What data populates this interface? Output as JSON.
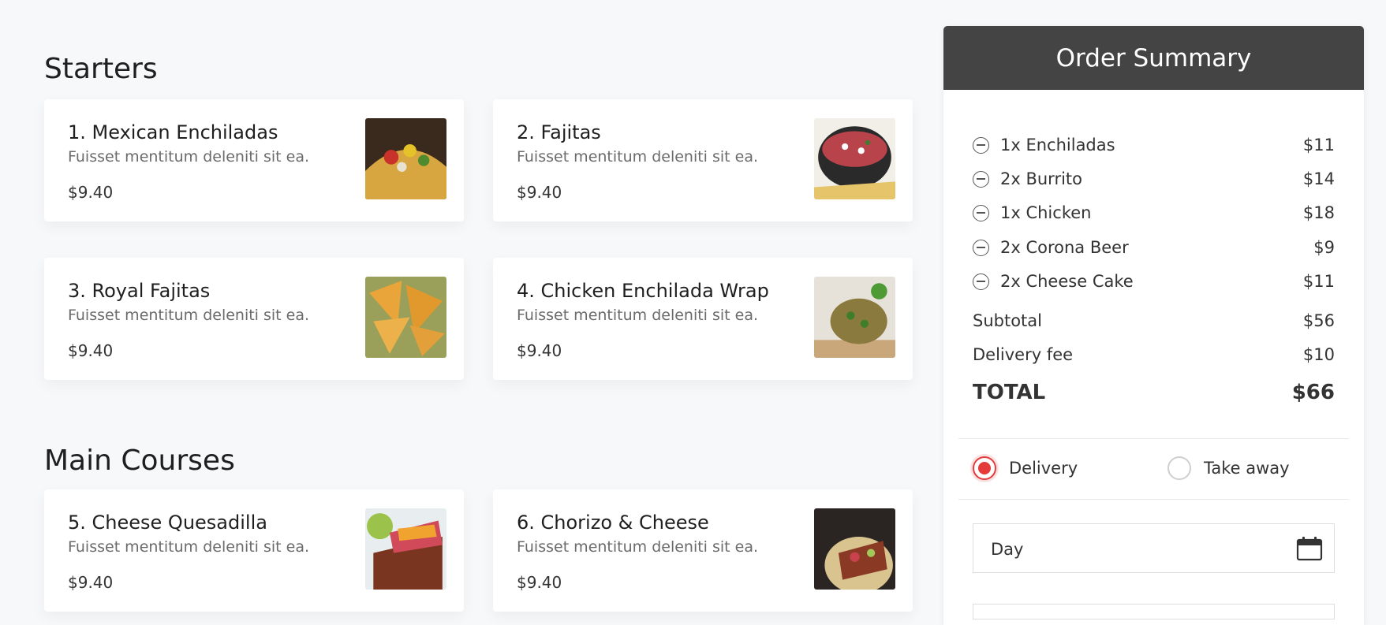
{
  "sections": {
    "starters_title": "Starters",
    "main_courses_title": "Main Courses"
  },
  "menu_items": [
    {
      "name": "1. Mexican Enchiladas",
      "description": "Fuisset mentitum deleniti sit ea.",
      "price": "$9.40"
    },
    {
      "name": "2. Fajitas",
      "description": "Fuisset mentitum deleniti sit ea.",
      "price": "$9.40"
    },
    {
      "name": "3. Royal Fajitas",
      "description": "Fuisset mentitum deleniti sit ea.",
      "price": "$9.40"
    },
    {
      "name": "4. Chicken Enchilada Wrap",
      "description": "Fuisset mentitum deleniti sit ea.",
      "price": "$9.40"
    },
    {
      "name": "5. Cheese Quesadilla",
      "description": "Fuisset mentitum deleniti sit ea.",
      "price": "$9.40"
    },
    {
      "name": "6. Chorizo & Cheese",
      "description": "Fuisset mentitum deleniti sit ea.",
      "price": "$9.40"
    }
  ],
  "order_summary": {
    "title": "Order Summary",
    "items": [
      {
        "label": "1x Enchiladas",
        "price": "$11"
      },
      {
        "label": "2x Burrito",
        "price": "$14"
      },
      {
        "label": "1x Chicken",
        "price": "$18"
      },
      {
        "label": "2x Corona Beer",
        "price": "$9"
      },
      {
        "label": "2x Cheese Cake",
        "price": "$11"
      }
    ],
    "subtotal_label": "Subtotal",
    "subtotal_value": "$56",
    "delivery_fee_label": "Delivery fee",
    "delivery_fee_value": "$10",
    "total_label": "TOTAL",
    "total_value": "$66",
    "options": [
      {
        "label": "Delivery",
        "selected": true
      },
      {
        "label": "Take away",
        "selected": false
      }
    ],
    "day_label": "Day"
  },
  "colors": {
    "accent": "#e53a3a",
    "header_bg": "#444444",
    "page_bg": "#f7f8fa"
  }
}
